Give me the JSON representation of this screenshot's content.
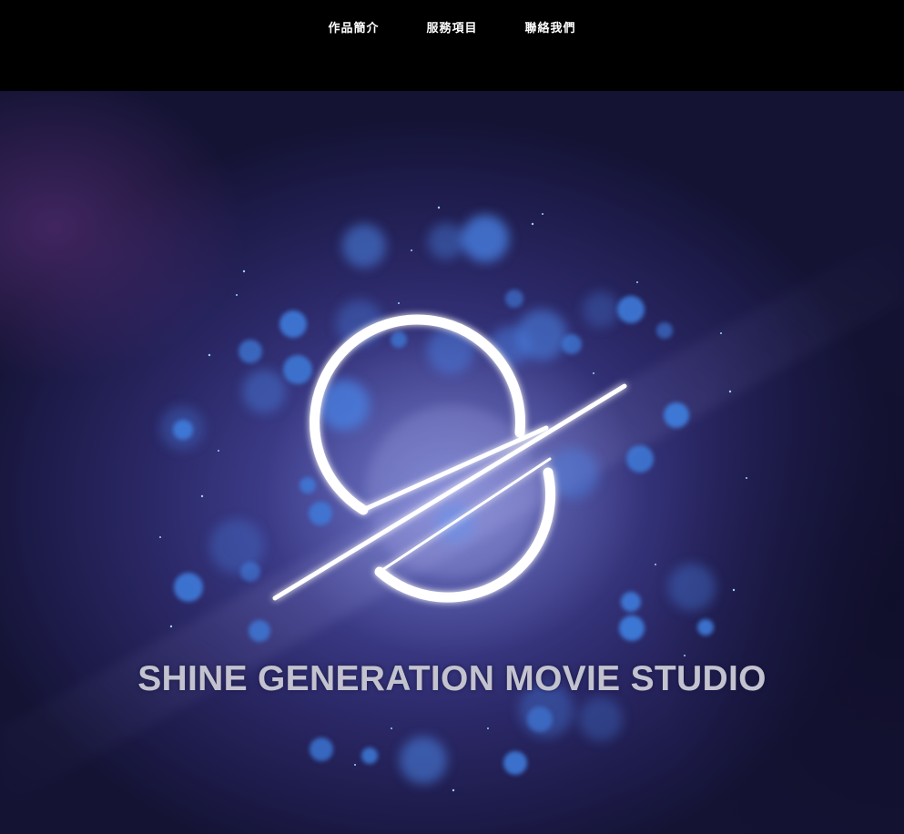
{
  "nav": {
    "items": [
      {
        "label": "作品簡介"
      },
      {
        "label": "服務項目"
      },
      {
        "label": "聯絡我們"
      }
    ]
  },
  "hero": {
    "title": "SHINE GENERATION MOVIE STUDIO",
    "logo": "planet-slash-logo"
  },
  "colors": {
    "topbar": "#000000",
    "nav_text": "#ffffff",
    "hero_base": "#2a2765",
    "bokeh": "#3f7fe0",
    "title_text": "#c3c2cf"
  }
}
